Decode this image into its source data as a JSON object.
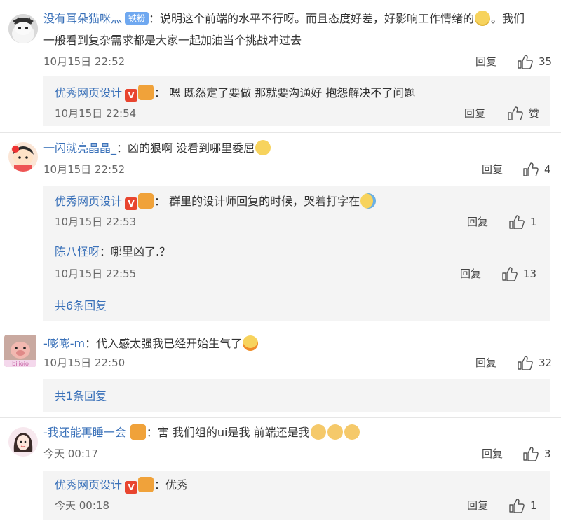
{
  "comments": [
    {
      "user": "没有耳朵猫咪灬",
      "badge": "铁粉",
      "text_line1": "：说明这个前端的水平不行呀。而且态度好差，好影响工作情绪的",
      "text_line1_tail": "。我们",
      "text_line2": "一般看到复杂需求都是大家一起加油当个挑战冲过去",
      "time": "10月15日 22:52",
      "reply": "回复",
      "likes": "35",
      "replies": [
        {
          "user": "优秀网页设计",
          "text": "：  嗯  既然定了要做    那就要沟通好    抱怨解决不了问题",
          "time": "10月15日 22:54",
          "reply": "回复",
          "likes": "赞"
        }
      ]
    },
    {
      "user": "一闪就亮晶晶_",
      "text": "：凶的狠啊 没看到哪里委屈",
      "time": "10月15日 22:52",
      "reply": "回复",
      "likes": "4",
      "replies": [
        {
          "user": "优秀网页设计",
          "text": "：  群里的设计师回复的时候，哭着打字在",
          "time": "10月15日 22:53",
          "reply": "回复",
          "likes": "1"
        },
        {
          "user": "陈八怪呀",
          "text": "：哪里凶了.？",
          "time": "10月15日 22:55",
          "reply": "回复",
          "likes": "13"
        }
      ],
      "more": "共6条回复"
    },
    {
      "user": "-嘭嘭-m",
      "text": "：代入感太强我已经开始生气了",
      "time": "10月15日 22:50",
      "reply": "回复",
      "likes": "32",
      "more": "共1条回复"
    },
    {
      "user": "-我还能再睡一会",
      "text": "：害  我们组的ui是我 前端还是我",
      "time": "今天 00:17",
      "reply": "回复",
      "likes": "3",
      "replies": [
        {
          "user": "优秀网页设计",
          "text": "：优秀",
          "time": "今天 00:18",
          "reply": "回复",
          "likes": "1"
        }
      ]
    }
  ],
  "badge_v": "V",
  "avatar_label_3": "bilioio"
}
